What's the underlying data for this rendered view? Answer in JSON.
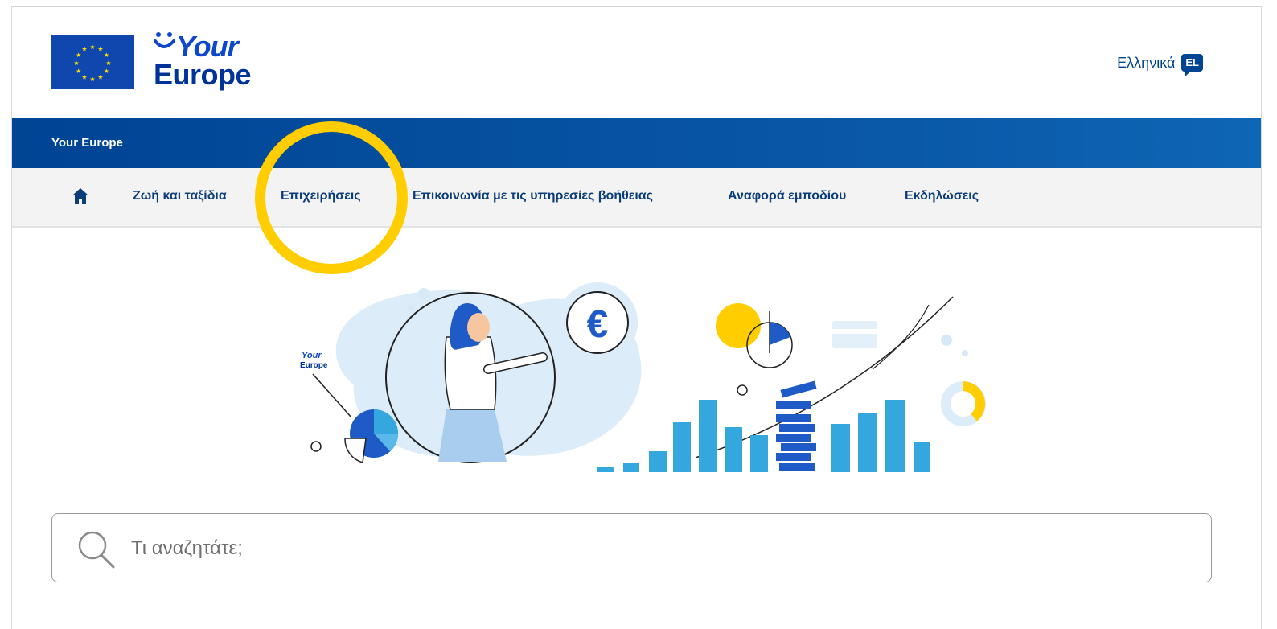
{
  "logo": {
    "your": "Your",
    "europe": "Europe"
  },
  "language": {
    "label": "Ελληνικά",
    "code": "EL"
  },
  "site_bar": {
    "title": "Your Europe"
  },
  "nav": {
    "home_icon": "home-icon",
    "items": [
      {
        "label": "Ζωή και ταξίδια"
      },
      {
        "label": "Επιχειρήσεις"
      },
      {
        "label": "Επικοινωνία με τις υπηρεσίες βοήθειας"
      },
      {
        "label": "Αναφορά εμποδίου"
      },
      {
        "label": "Εκδηλώσεις"
      }
    ]
  },
  "hero": {
    "logo_your": "Your",
    "logo_europe": "Europe",
    "currency_symbol": "€"
  },
  "search": {
    "placeholder": "Τι αναζητάτε;",
    "value": ""
  },
  "colors": {
    "brand_blue": "#004494",
    "highlight_ring": "#ffcd00",
    "illustration_light_blue": "#35a7df"
  }
}
